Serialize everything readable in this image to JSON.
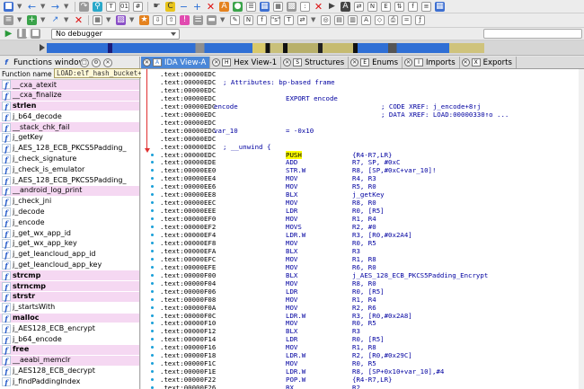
{
  "toolbar": {
    "row1_icons": [
      "save-icon",
      "undo-icon",
      "redo-icon",
      "back-icon",
      "forward-icon",
      "jump-icon",
      "search-icon",
      "search-next-icon",
      "text-search-icon",
      "binary-search-icon",
      "immediate-search-icon",
      "sequence-icon",
      "code-icon",
      "data-icon",
      "string-icon",
      "array-icon",
      "undefine-icon",
      "struct-icon",
      "enum-icon",
      "rename-icon",
      "offset-icon",
      "comment-icon",
      "function-icon",
      "segment-icon",
      "hex-icon",
      "name-icon",
      "xref-icon",
      "graph-icon",
      "flow-icon",
      "calls-icon"
    ],
    "debugger_label": "No debugger"
  },
  "function_window": {
    "title": "Functions window",
    "column_header": "Function name",
    "tooltip": "LOAD:elf_hash_bucket+3C",
    "items": [
      {
        "name": "__cxa_atexit",
        "style": "pink"
      },
      {
        "name": "__cxa_finalize",
        "style": "pink"
      },
      {
        "name": "strlen",
        "style": "pink-bold"
      },
      {
        "name": "j_b64_decode",
        "style": "white"
      },
      {
        "name": "__stack_chk_fail",
        "style": "pink"
      },
      {
        "name": "j_getKey",
        "style": "white"
      },
      {
        "name": "j_AES_128_ECB_PKCS5Padding_",
        "style": "white"
      },
      {
        "name": "j_check_signature",
        "style": "white"
      },
      {
        "name": "j_check_is_emulator",
        "style": "white"
      },
      {
        "name": "j_AES_128_ECB_PKCS5Padding_",
        "style": "white"
      },
      {
        "name": "__android_log_print",
        "style": "pink"
      },
      {
        "name": "j_check_jni",
        "style": "white"
      },
      {
        "name": "j_decode",
        "style": "white"
      },
      {
        "name": "j_encode",
        "style": "white"
      },
      {
        "name": "j_get_wx_app_id",
        "style": "white"
      },
      {
        "name": "j_get_wx_app_key",
        "style": "white"
      },
      {
        "name": "j_get_leancloud_app_id",
        "style": "white"
      },
      {
        "name": "j_get_leancloud_app_key",
        "style": "white"
      },
      {
        "name": "strcmp",
        "style": "pink-bold"
      },
      {
        "name": "strncmp",
        "style": "pink-bold"
      },
      {
        "name": "strstr",
        "style": "pink-bold"
      },
      {
        "name": "j_startsWith",
        "style": "white"
      },
      {
        "name": "malloc",
        "style": "pink-bold"
      },
      {
        "name": "j_AES128_ECB_encrypt",
        "style": "white"
      },
      {
        "name": "j_b64_encode",
        "style": "white"
      },
      {
        "name": "free",
        "style": "pink-bold"
      },
      {
        "name": "__aeabi_memclr",
        "style": "pink"
      },
      {
        "name": "j_AES128_ECB_decrypt",
        "style": "white"
      },
      {
        "name": "j_findPaddingIndex",
        "style": "white"
      }
    ]
  },
  "tabs": [
    {
      "label": "IDA View-A",
      "active": true
    },
    {
      "label": "Hex View-1",
      "active": false
    },
    {
      "label": "Structures",
      "active": false
    },
    {
      "label": "Enums",
      "active": false
    },
    {
      "label": "Imports",
      "active": false
    },
    {
      "label": "Exports",
      "active": false
    }
  ],
  "disasm": {
    "lines": [
      {
        "addr": ".text:00000EDC",
        "kind": "plain",
        "text": ""
      },
      {
        "addr": ".text:00000EDC",
        "kind": "comment",
        "text": "; Attributes: bp-based frame"
      },
      {
        "addr": ".text:00000EDC",
        "kind": "plain",
        "text": ""
      },
      {
        "addr": ".text:00000EDC",
        "kind": "export",
        "text": "EXPORT encode"
      },
      {
        "addr": ".text:00000EDC",
        "kind": "label-xref",
        "label": "encode",
        "xref": "; CODE XREF: j_encode+8↑j"
      },
      {
        "addr": ".text:00000EDC",
        "kind": "xref",
        "xref": "; DATA XREF: LOAD:00000330↑o ..."
      },
      {
        "addr": ".text:00000EDC",
        "kind": "plain",
        "text": ""
      },
      {
        "addr": ".text:00000EDC",
        "kind": "var",
        "label": "var_10",
        "value": "= -0x10"
      },
      {
        "addr": ".text:00000EDC",
        "kind": "plain",
        "text": ""
      },
      {
        "addr": ".text:00000EDC",
        "kind": "comment",
        "text": "; __unwind {"
      },
      {
        "addr": ".text:00000EDC",
        "kind": "insn",
        "mn": "PUSH",
        "op": "{R4-R7,LR}",
        "hl": true
      },
      {
        "addr": ".text:00000EDE",
        "kind": "insn",
        "mn": "ADD",
        "op": "R7, SP, #0xC"
      },
      {
        "addr": ".text:00000EE0",
        "kind": "insn",
        "mn": "STR.W",
        "op": "R8, [SP,#0xC+var_10]!"
      },
      {
        "addr": ".text:00000EE4",
        "kind": "insn",
        "mn": "MOV",
        "op": "R4, R3"
      },
      {
        "addr": ".text:00000EE6",
        "kind": "insn",
        "mn": "MOV",
        "op": "R5, R0"
      },
      {
        "addr": ".text:00000EE8",
        "kind": "insn",
        "mn": "BLX",
        "op": "j_getKey"
      },
      {
        "addr": ".text:00000EEC",
        "kind": "insn",
        "mn": "MOV",
        "op": "R8, R0"
      },
      {
        "addr": ".text:00000EEE",
        "kind": "insn",
        "mn": "LDR",
        "op": "R0, [R5]"
      },
      {
        "addr": ".text:00000EF0",
        "kind": "insn",
        "mn": "MOV",
        "op": "R1, R4"
      },
      {
        "addr": ".text:00000EF2",
        "kind": "insn",
        "mn": "MOVS",
        "op": "R2, #0"
      },
      {
        "addr": ".text:00000EF4",
        "kind": "insn",
        "mn": "LDR.W",
        "op": "R3, [R0,#0x2A4]"
      },
      {
        "addr": ".text:00000EF8",
        "kind": "insn",
        "mn": "MOV",
        "op": "R0, R5"
      },
      {
        "addr": ".text:00000EFA",
        "kind": "insn",
        "mn": "BLX",
        "op": "R3"
      },
      {
        "addr": ".text:00000EFC",
        "kind": "insn",
        "mn": "MOV",
        "op": "R1, R8"
      },
      {
        "addr": ".text:00000EFE",
        "kind": "insn",
        "mn": "MOV",
        "op": "R6, R0"
      },
      {
        "addr": ".text:00000F00",
        "kind": "insn",
        "mn": "BLX",
        "op": "j_AES_128_ECB_PKCS5Padding_Encrypt"
      },
      {
        "addr": ".text:00000F04",
        "kind": "insn",
        "mn": "MOV",
        "op": "R8, R0"
      },
      {
        "addr": ".text:00000F06",
        "kind": "insn",
        "mn": "LDR",
        "op": "R0, [R5]"
      },
      {
        "addr": ".text:00000F08",
        "kind": "insn",
        "mn": "MOV",
        "op": "R1, R4"
      },
      {
        "addr": ".text:00000F0A",
        "kind": "insn",
        "mn": "MOV",
        "op": "R2, R6"
      },
      {
        "addr": ".text:00000F0C",
        "kind": "insn",
        "mn": "LDR.W",
        "op": "R3, [R0,#0x2A8]"
      },
      {
        "addr": ".text:00000F10",
        "kind": "insn",
        "mn": "MOV",
        "op": "R0, R5"
      },
      {
        "addr": ".text:00000F12",
        "kind": "insn",
        "mn": "BLX",
        "op": "R3"
      },
      {
        "addr": ".text:00000F14",
        "kind": "insn",
        "mn": "LDR",
        "op": "R0, [R5]"
      },
      {
        "addr": ".text:00000F16",
        "kind": "insn",
        "mn": "MOV",
        "op": "R1, R8"
      },
      {
        "addr": ".text:00000F18",
        "kind": "insn",
        "mn": "LDR.W",
        "op": "R2, [R0,#0x29C]"
      },
      {
        "addr": ".text:00000F1C",
        "kind": "insn",
        "mn": "MOV",
        "op": "R0, R5"
      },
      {
        "addr": ".text:00000F1E",
        "kind": "insn",
        "mn": "LDR.W",
        "op": "R8, [SP+0x10+var_10],#4"
      },
      {
        "addr": ".text:00000F22",
        "kind": "insn",
        "mn": "POP.W",
        "op": "{R4-R7,LR}"
      },
      {
        "addr": ".text:00000F26",
        "kind": "insn",
        "mn": "BX",
        "op": "R2"
      }
    ]
  }
}
